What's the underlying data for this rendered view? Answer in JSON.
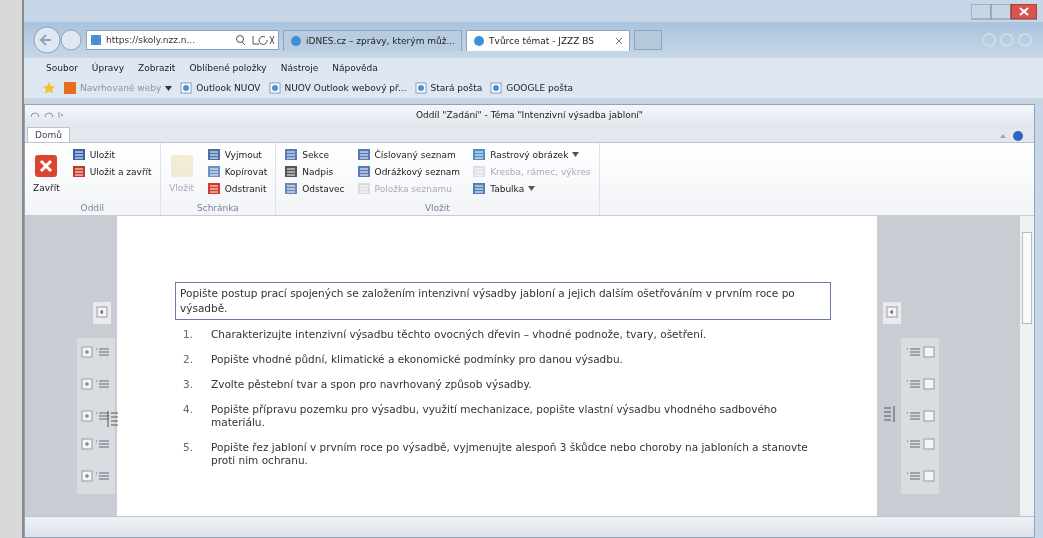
{
  "browser": {
    "address": "https://skoly.nzz.n...",
    "tabs": [
      {
        "title": "iDNES.cz – zprávy, kterým můž...",
        "selected": false
      },
      {
        "title": "Tvůrce témat - JZZZ BS",
        "selected": true
      }
    ],
    "menu": [
      "Soubor",
      "Úpravy",
      "Zobrazit",
      "Oblíbené položky",
      "Nástroje",
      "Nápověda"
    ],
    "favorites": [
      {
        "label": "Navrhované weby",
        "kind": "dropdown"
      },
      {
        "label": "Outlook NUOV",
        "kind": "link"
      },
      {
        "label": "NUOV Outlook webový př...",
        "kind": "link"
      },
      {
        "label": "Stará pošta",
        "kind": "link"
      },
      {
        "label": "GOOGLE pošta",
        "kind": "link"
      }
    ]
  },
  "app": {
    "title": "Oddíl \"Zadání\" - Téma \"Intenzivní výsadba jabloní\"",
    "ribbon_tabs": [
      {
        "label": "Domů",
        "selected": true
      }
    ],
    "groups": [
      {
        "label": "Oddíl",
        "columns": [
          [
            {
              "label": "Zavřít",
              "kind": "large",
              "disabled": false
            }
          ],
          [
            {
              "label": "Uložit",
              "kind": "small",
              "disabled": false
            },
            {
              "label": "Uložit a zavřít",
              "kind": "small",
              "disabled": false
            }
          ]
        ]
      },
      {
        "label": "Schránka",
        "columns": [
          [
            {
              "label": "Vložit",
              "kind": "large",
              "disabled": true
            }
          ],
          [
            {
              "label": "Vyjmout",
              "kind": "small",
              "disabled": false
            },
            {
              "label": "Kopírovat",
              "kind": "small",
              "disabled": false
            },
            {
              "label": "Odstranit",
              "kind": "small",
              "disabled": false
            }
          ]
        ]
      },
      {
        "label": "Vložit",
        "columns": [
          [
            {
              "label": "Sekce",
              "kind": "small",
              "disabled": false
            },
            {
              "label": "Nadpis",
              "kind": "small",
              "disabled": false
            },
            {
              "label": "Odstavec",
              "kind": "small",
              "disabled": false
            }
          ],
          [
            {
              "label": "Číslovaný seznam",
              "kind": "small",
              "disabled": false
            },
            {
              "label": "Odrážkový seznam",
              "kind": "small",
              "disabled": false
            },
            {
              "label": "Položka seznamu",
              "kind": "small",
              "disabled": true
            }
          ],
          [
            {
              "label": "Rastrový obrázek",
              "kind": "dropdown",
              "disabled": false
            },
            {
              "label": "Kresba, rámec, výkres",
              "kind": "small",
              "disabled": true
            },
            {
              "label": "Tabulka",
              "kind": "dropdown",
              "disabled": false
            }
          ]
        ]
      }
    ]
  },
  "document": {
    "intro": "Popište postup prací spojených se založením intenzivní výsadby jabloní a jejich dalším ošetřováním v prvním roce po výsadbě.",
    "items": [
      {
        "number": "1.",
        "text": "Charakterizujte intenzivní výsadbu těchto ovocných dřevin – vhodné podnože, tvary, ošetření."
      },
      {
        "number": "2.",
        "text": "Popište vhodné půdní, klimatické a ekonomické podmínky pro danou výsadbu."
      },
      {
        "number": "3.",
        "text": "Zvolte pěstební tvar a spon pro navrhovaný způsob výsadby."
      },
      {
        "number": "4.",
        "text": "Popište přípravu pozemku pro výsadbu, využití mechanizace, popište vlastní výsadbu vhodného sadbového materiálu."
      },
      {
        "number": "5.",
        "text": "Popište řez jabloní v prvním roce po výsadbě, vyjmenujte alespoň 3 škůdce nebo choroby na jabloních a stanovte proti nim ochranu."
      }
    ]
  }
}
